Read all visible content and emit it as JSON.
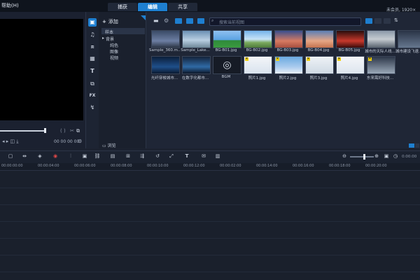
{
  "window": {
    "title": "帮助(H)",
    "user_info": "未会员, 1920×"
  },
  "mode_tabs": [
    {
      "label": "捕获"
    },
    {
      "label": "编辑"
    },
    {
      "label": "共享"
    }
  ],
  "preview": {
    "timecode": "00 00 00 00"
  },
  "library_tree": {
    "add_label": "添加",
    "items": [
      {
        "label": "样本"
      },
      {
        "label": "背景"
      },
      {
        "label": "纯色"
      },
      {
        "label": "图像"
      },
      {
        "label": "视频"
      }
    ],
    "browse_label": "浏览"
  },
  "search": {
    "placeholder": "搜索当前视图"
  },
  "media": [
    {
      "caption": "Sample_360.m...",
      "badge": false
    },
    {
      "caption": "Sample_Lake...",
      "badge": false
    },
    {
      "caption": "BG-B01.jpg",
      "badge": false
    },
    {
      "caption": "BG-B02.jpg",
      "badge": false
    },
    {
      "caption": "BG-B03.jpg",
      "badge": false
    },
    {
      "caption": "BG-B04.jpg",
      "badge": false
    },
    {
      "caption": "BG-B05.jpg",
      "badge": false
    },
    {
      "caption": "城市的天际人线...",
      "badge": false
    },
    {
      "caption": "城市建设飞速...",
      "badge": false
    },
    {
      "caption": "光纤穿梭城市...",
      "badge": false
    },
    {
      "caption": "在数字化都市...",
      "badge": false
    },
    {
      "caption": "BGM",
      "badge": false
    },
    {
      "caption": "照片1.jpg",
      "badge": true
    },
    {
      "caption": "照片2.jpg",
      "badge": true
    },
    {
      "caption": "照片3.jpg",
      "badge": true
    },
    {
      "caption": "照片4.jpg",
      "badge": true
    },
    {
      "caption": "东来需好科技...",
      "badge": true
    }
  ],
  "timeline": {
    "ticks": [
      "00:00:00:00",
      "00:00:02:00",
      "00:00:04:00",
      "00:00:06:00",
      "00:00:08:00",
      "00:00:10:00",
      "00:00:12:00",
      "00:00:14:00",
      "00:00:16:00",
      "00:00:18:00",
      "00:00:20:00"
    ],
    "timecode": "0:00:00"
  }
}
